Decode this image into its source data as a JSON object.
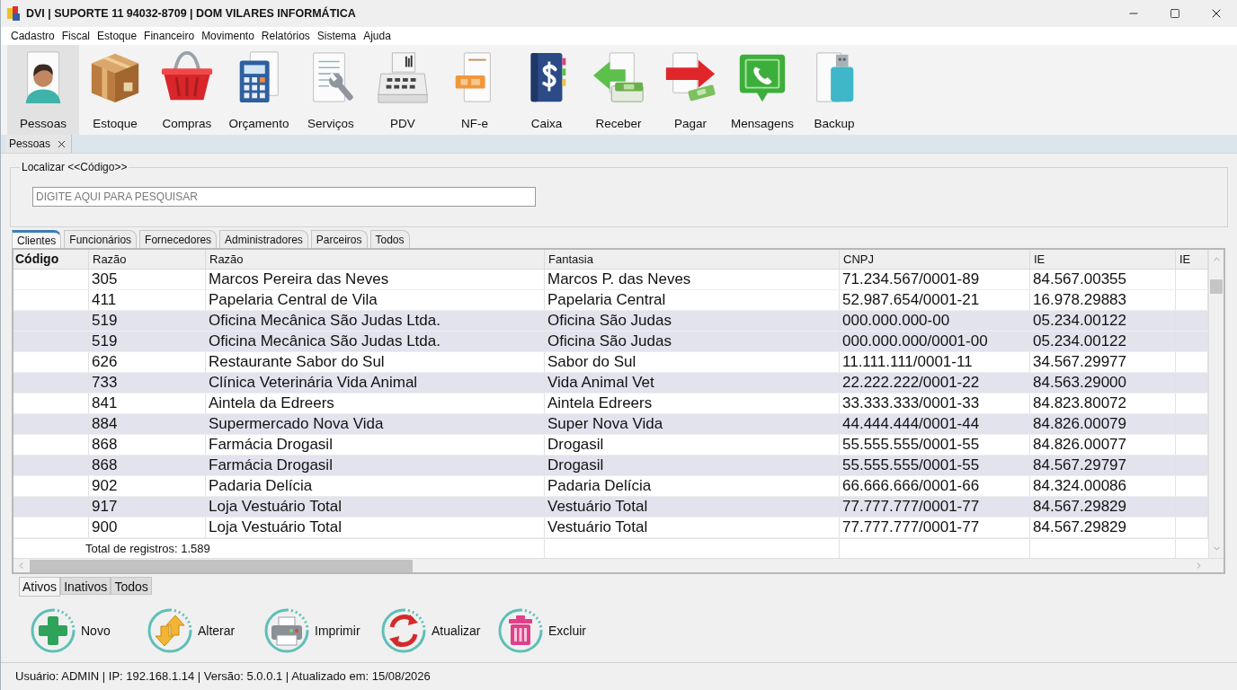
{
  "window": {
    "title": "DVI | SUPORTE 11 94032-8709 | DOM VILARES INFORMÁTICA"
  },
  "menu": [
    "Cadastro",
    "Fiscal",
    "Estoque",
    "Financeiro",
    "Movimento",
    "Relatórios",
    "Sistema",
    "Ajuda"
  ],
  "toolbar": [
    {
      "label": "Pessoas",
      "selected": true
    },
    {
      "label": "Estoque",
      "selected": false
    },
    {
      "label": "Compras",
      "selected": false
    },
    {
      "label": "Orçamento",
      "selected": false
    },
    {
      "label": "Serviços",
      "selected": false
    },
    {
      "label": "PDV",
      "selected": false
    },
    {
      "label": "NF-e",
      "selected": false
    },
    {
      "label": "Caixa",
      "selected": false
    },
    {
      "label": "Receber",
      "selected": false
    },
    {
      "label": "Pagar",
      "selected": false
    },
    {
      "label": "Mensagens",
      "selected": false
    },
    {
      "label": "Backup",
      "selected": false
    }
  ],
  "document_tabs": [
    {
      "label": "Pessoas",
      "selected": true
    }
  ],
  "search": {
    "legend": "Localizar <<Código>>",
    "placeholder": "DIGITE AQUI PARA PESQUISAR"
  },
  "tabs": [
    {
      "label": "Clientes",
      "selected": true
    },
    {
      "label": "Funcionários",
      "selected": false
    },
    {
      "label": "Fornecedores",
      "selected": false
    },
    {
      "label": "Administradores",
      "selected": false
    },
    {
      "label": "Parceiros",
      "selected": false
    },
    {
      "label": "Todos",
      "selected": false
    }
  ],
  "table": {
    "columns": [
      "Código",
      "Razão",
      "Razão",
      "Fantasia",
      "CNPJ",
      "IE",
      "IE"
    ],
    "rows": [
      {
        "shaded": false,
        "cells": [
          "",
          "305",
          "Marcos Pereira das Neves",
          "Marcos P. das Neves",
          "71.234.567/0001-89",
          "84.567.00355"
        ]
      },
      {
        "shaded": false,
        "cells": [
          "",
          "411",
          "Papelaria Central de Vila",
          "Papelaria Central",
          "52.987.654/0001-21",
          "16.978.29883"
        ]
      },
      {
        "shaded": true,
        "cells": [
          "",
          "519",
          "Oficina Mecânica São Judas Ltda.",
          "Oficina São Judas",
          "000.000.000-00",
          "05.234.00122"
        ]
      },
      {
        "shaded": true,
        "cells": [
          "",
          "519",
          "Oficina Mecânica São Judas Ltda.",
          "Oficina São Judas",
          "000.000.000/0001-00",
          "05.234.00122"
        ]
      },
      {
        "shaded": false,
        "cells": [
          "",
          "626",
          "Restaurante Sabor do Sul",
          "Sabor do Sul",
          "11.111.111/0001-11",
          "34.567.29977"
        ]
      },
      {
        "shaded": true,
        "cells": [
          "",
          "733",
          "Clínica Veterinária Vida Animal",
          "Vida Animal Vet",
          "22.222.222/0001-22",
          "84.563.29000"
        ]
      },
      {
        "shaded": false,
        "cells": [
          "",
          "841",
          "Aintela da Edreers",
          "Aintela Edreers",
          "33.333.333/0001-33",
          "84.823.80072"
        ]
      },
      {
        "shaded": true,
        "cells": [
          "",
          "884",
          "Supermercado Nova Vida",
          "Super Nova Vida",
          "44.444.444/0001-44",
          "84.826.00079"
        ]
      },
      {
        "shaded": false,
        "cells": [
          "",
          "868",
          "Farmácia Drogasil",
          "Drogasil",
          "55.555.555/0001-55",
          "84.826.00077"
        ]
      },
      {
        "shaded": true,
        "cells": [
          "",
          "868",
          "Farmácia Drogasil",
          "Drogasil",
          "55.555.555/0001-55",
          "84.567.29797"
        ]
      },
      {
        "shaded": false,
        "cells": [
          "",
          "902",
          "Padaria Delícia",
          "Padaria Delícia",
          "66.666.666/0001-66",
          "84.324.00086"
        ]
      },
      {
        "shaded": true,
        "cells": [
          "",
          "917",
          "Loja Vestuário Total",
          "Vestuário Total",
          "77.777.777/0001-77",
          "84.567.29829"
        ]
      },
      {
        "shaded": false,
        "cells": [
          "",
          "900",
          "Loja Vestuário Total",
          "Vestuário Total",
          "77.777.777/0001-77",
          "84.567.29829"
        ]
      }
    ],
    "footer": "Total de registros: 1.589"
  },
  "filter_tabs": [
    {
      "label": "Ativos",
      "selected": true
    },
    {
      "label": "Inativos",
      "selected": false
    },
    {
      "label": "Todos",
      "selected": false
    }
  ],
  "actions": [
    "Novo",
    "Alterar",
    "Imprimir",
    "Atualizar",
    "Excluir"
  ],
  "status_bar": "Usuário: ADMIN | IP: 192.168.1.14 | Versão: 5.0.0.1 | Atualizado em: 15/08/2026"
}
